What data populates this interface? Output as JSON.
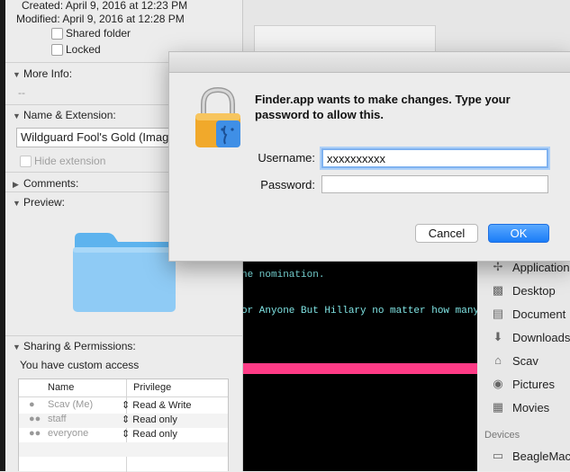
{
  "info_panel": {
    "created": "Created: April 9, 2016 at 12:23 PM",
    "modified": "Modified: April 9, 2016 at 12:28 PM",
    "shared_folder": "Shared folder",
    "locked": "Locked",
    "more_info_title": "More Info:",
    "more_info_value": "--",
    "name_ext_title": "Name & Extension:",
    "name_value": "Wildguard Fool's Gold (Imag",
    "hide_extension": "Hide extension",
    "comments_title": "Comments:",
    "preview_title": "Preview:",
    "sharing_title": "Sharing & Permissions:",
    "custom_access": "You have custom access",
    "perm_headers": {
      "name": "Name",
      "privilege": "Privilege"
    },
    "perm_rows": [
      {
        "name": "Scav (Me)",
        "privilege": "Read & Write"
      },
      {
        "name": "staff",
        "privilege": "Read only"
      },
      {
        "name": "everyone",
        "privilege": "Read only"
      }
    ]
  },
  "terminal": {
    "line1": "ne nomination.",
    "line2": "or Anyone But Hillary no matter how many"
  },
  "finder_sidebar": {
    "items": [
      "Application",
      "Desktop",
      "Document",
      "Downloads",
      "Scav",
      "Pictures",
      "Movies"
    ],
    "devices_header": "Devices",
    "device": "BeagleMac"
  },
  "dialog": {
    "message": "Finder.app wants to make changes. Type your password to allow this.",
    "username_label": "Username:",
    "username_value": "xxxxxxxxxx",
    "password_label": "Password:",
    "password_value": "",
    "cancel_label": "Cancel",
    "ok_label": "OK"
  },
  "colors": {
    "accent": "#1a7cf7",
    "terminal_bg": "#000000",
    "terminal_text": "#7fe3e3",
    "pink": "#ff3b86"
  }
}
